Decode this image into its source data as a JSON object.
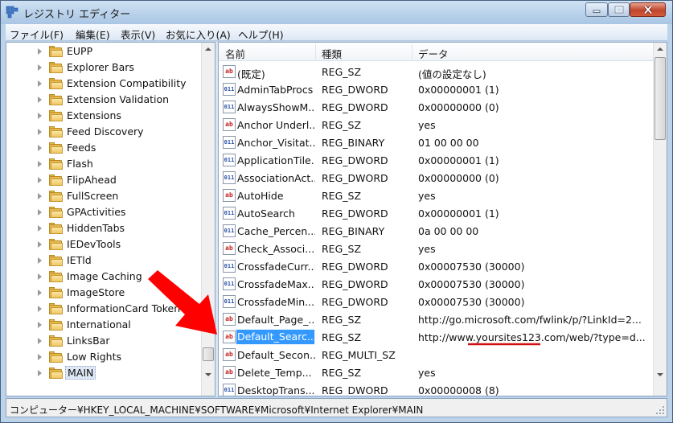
{
  "window": {
    "title": "レジストリ エディター",
    "icon": "registry-editor-icon",
    "controls": [
      "minimize-icon",
      "maximize-icon",
      "close-icon"
    ]
  },
  "menubar": [
    {
      "label": "ファイル(F)"
    },
    {
      "label": "編集(E)"
    },
    {
      "label": "表示(V)"
    },
    {
      "label": "お気に入り(A)"
    },
    {
      "label": "ヘルプ(H)"
    }
  ],
  "tree": {
    "items": [
      {
        "label": "EUPP"
      },
      {
        "label": "Explorer Bars"
      },
      {
        "label": "Extension Compatibility"
      },
      {
        "label": "Extension Validation"
      },
      {
        "label": "Extensions"
      },
      {
        "label": "Feed Discovery"
      },
      {
        "label": "Feeds"
      },
      {
        "label": "Flash"
      },
      {
        "label": "FlipAhead"
      },
      {
        "label": "FullScreen"
      },
      {
        "label": "GPActivities"
      },
      {
        "label": "HiddenTabs"
      },
      {
        "label": "IEDevTools"
      },
      {
        "label": "IETld"
      },
      {
        "label": "Image Caching"
      },
      {
        "label": "ImageStore"
      },
      {
        "label": "InformationCard Token"
      },
      {
        "label": "International"
      },
      {
        "label": "LinksBar"
      },
      {
        "label": "Low Rights"
      },
      {
        "label": "MAIN"
      }
    ],
    "selected": "MAIN"
  },
  "list": {
    "columns": {
      "name": "名前",
      "type": "種類",
      "data": "データ"
    },
    "rows": [
      {
        "name": "(既定)",
        "type": "REG_SZ",
        "data": "(値の設定なし)",
        "icon": "string-value-icon"
      },
      {
        "name": "AdminTabProcs",
        "type": "REG_DWORD",
        "data": "0x00000001 (1)",
        "icon": "binary-value-icon"
      },
      {
        "name": "AlwaysShowM...",
        "type": "REG_DWORD",
        "data": "0x00000000 (0)",
        "icon": "binary-value-icon"
      },
      {
        "name": "Anchor Underl...",
        "type": "REG_SZ",
        "data": "yes",
        "icon": "string-value-icon"
      },
      {
        "name": "Anchor_Visitat...",
        "type": "REG_BINARY",
        "data": "01 00 00 00",
        "icon": "binary-value-icon"
      },
      {
        "name": "ApplicationTile...",
        "type": "REG_DWORD",
        "data": "0x00000001 (1)",
        "icon": "binary-value-icon"
      },
      {
        "name": "AssociationAct...",
        "type": "REG_DWORD",
        "data": "0x00000000 (0)",
        "icon": "binary-value-icon"
      },
      {
        "name": "AutoHide",
        "type": "REG_SZ",
        "data": "yes",
        "icon": "string-value-icon"
      },
      {
        "name": "AutoSearch",
        "type": "REG_DWORD",
        "data": "0x00000001 (1)",
        "icon": "binary-value-icon"
      },
      {
        "name": "Cache_Percen...",
        "type": "REG_BINARY",
        "data": "0a 00 00 00",
        "icon": "binary-value-icon"
      },
      {
        "name": "Check_Associ...",
        "type": "REG_SZ",
        "data": "yes",
        "icon": "string-value-icon"
      },
      {
        "name": "CrossfadeCurr...",
        "type": "REG_DWORD",
        "data": "0x00007530 (30000)",
        "icon": "binary-value-icon"
      },
      {
        "name": "CrossfadeMax...",
        "type": "REG_DWORD",
        "data": "0x00007530 (30000)",
        "icon": "binary-value-icon"
      },
      {
        "name": "CrossfadeMin...",
        "type": "REG_DWORD",
        "data": "0x00007530 (30000)",
        "icon": "binary-value-icon"
      },
      {
        "name": "Default_Page_...",
        "type": "REG_SZ",
        "data": "http://go.microsoft.com/fwlink/p/?LinkId=2...",
        "icon": "string-value-icon"
      },
      {
        "name": "Default_Searc...",
        "type": "REG_SZ",
        "data": "http://www.yoursites123.com/web/?type=d...",
        "icon": "string-value-icon"
      },
      {
        "name": "Default_Secon...",
        "type": "REG_MULTI_SZ",
        "data": "",
        "icon": "string-value-icon"
      },
      {
        "name": "Delete_Temp...",
        "type": "REG_SZ",
        "data": "yes",
        "icon": "string-value-icon"
      },
      {
        "name": "DesktopTrans...",
        "type": "REG_DWORD",
        "data": "0x00000008 (8)",
        "icon": "binary-value-icon"
      }
    ],
    "selected": "Default_Searc..."
  },
  "annotations": {
    "arrow": "red-arrow-icon",
    "arrow_color": "#ff0000",
    "underline_color": "#d01010"
  },
  "statusbar": {
    "path": "コンピューター¥HKEY_LOCAL_MACHINE¥SOFTWARE¥Microsoft¥Internet Explorer¥MAIN"
  },
  "colors": {
    "selection": "#3399ff",
    "title_gradient_top": "#cfe1f3",
    "frame": "#bcd3ea"
  }
}
